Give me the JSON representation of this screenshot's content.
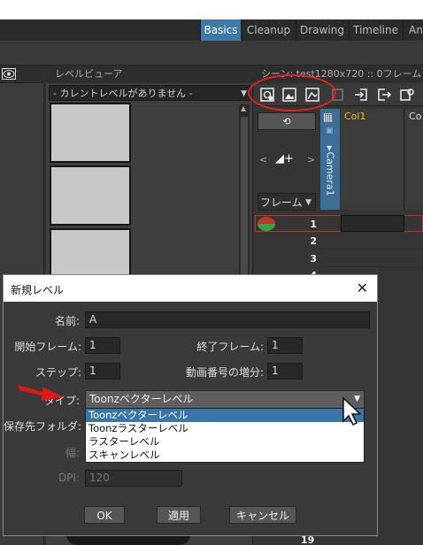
{
  "room_tabs": [
    {
      "label": "Basics",
      "active": true
    },
    {
      "label": "Cleanup",
      "active": false
    },
    {
      "label": "Drawing",
      "active": false
    },
    {
      "label": "Timeline",
      "active": false
    },
    {
      "label": "An",
      "active": false
    }
  ],
  "level_viewer": {
    "title": "レベルビューア",
    "combo_value": "- カレントレベルがありません -"
  },
  "xsheet": {
    "title": "シーン: test1280x720 :: 0フレーム",
    "toolbar_icons": [
      "new-vector-level-icon",
      "new-toonz-raster-level-icon",
      "new-raster-level-icon",
      "new-level-icon",
      "export-icon",
      "output-icon",
      "xsheet-settings-icon"
    ],
    "camera_label": "Camera1",
    "col1_name": "Col1",
    "col2_name": "Co",
    "frame_dropdown": "フレーム",
    "frame_numbers": [
      "1",
      "2",
      "3",
      "4"
    ],
    "bottom_frame": "19"
  },
  "dialog": {
    "title": "新規レベル",
    "name_label": "名前:",
    "name_value": "A",
    "start_label": "開始フレーム:",
    "start_value": "1",
    "end_label": "終了フレーム:",
    "end_value": "1",
    "step_label": "ステップ:",
    "step_value": "1",
    "inc_label": "動画番号の増分:",
    "inc_value": "1",
    "type_label": "タイプ:",
    "type_value": "Toonzベクターレベル",
    "type_options": [
      "Toonzベクターレベル",
      "Toonzラスターレベル",
      "ラスターレベル",
      "スキャンレベル"
    ],
    "save_label": "保存先フォルダ:",
    "width_label": "幅:",
    "dpi_label": "DPI:",
    "dpi_value": "120",
    "ok_label": "OK",
    "apply_label": "適用",
    "cancel_label": "キャンセル"
  },
  "colors": {
    "accent": "#3d7aa8",
    "highlight_red": "#e12222",
    "column_name": "#f5c400"
  }
}
